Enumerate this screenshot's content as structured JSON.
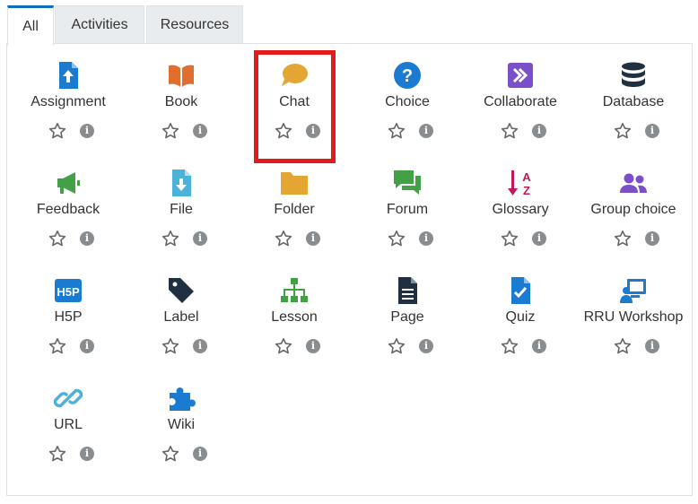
{
  "tabs": [
    {
      "label": "All",
      "active": true
    },
    {
      "label": "Activities",
      "active": false
    },
    {
      "label": "Resources",
      "active": false
    }
  ],
  "highlight_target": "Chat",
  "colors": {
    "assessment": "#1a7bd0",
    "content": "#e06e2c",
    "communication": "#e3a632",
    "collaboration": "#7a4fc7",
    "administration": "#203040",
    "interactive": "#43a047",
    "file": "#4bb3d9",
    "accent_box": "#e21b1b"
  },
  "items": [
    {
      "label": "Assignment",
      "icon": "assignment-icon"
    },
    {
      "label": "Book",
      "icon": "book-icon"
    },
    {
      "label": "Chat",
      "icon": "chat-icon"
    },
    {
      "label": "Choice",
      "icon": "choice-icon"
    },
    {
      "label": "Collaborate",
      "icon": "collaborate-icon"
    },
    {
      "label": "Database",
      "icon": "database-icon"
    },
    {
      "label": "Feedback",
      "icon": "feedback-icon"
    },
    {
      "label": "File",
      "icon": "file-icon"
    },
    {
      "label": "Folder",
      "icon": "folder-icon"
    },
    {
      "label": "Forum",
      "icon": "forum-icon"
    },
    {
      "label": "Glossary",
      "icon": "glossary-icon"
    },
    {
      "label": "Group choice",
      "icon": "group-choice-icon"
    },
    {
      "label": "H5P",
      "icon": "h5p-icon"
    },
    {
      "label": "Label",
      "icon": "label-icon"
    },
    {
      "label": "Lesson",
      "icon": "lesson-icon"
    },
    {
      "label": "Page",
      "icon": "page-icon"
    },
    {
      "label": "Quiz",
      "icon": "quiz-icon"
    },
    {
      "label": "RRU Workshop",
      "icon": "rru-workshop-icon"
    },
    {
      "label": "URL",
      "icon": "url-icon"
    },
    {
      "label": "Wiki",
      "icon": "wiki-icon"
    }
  ]
}
